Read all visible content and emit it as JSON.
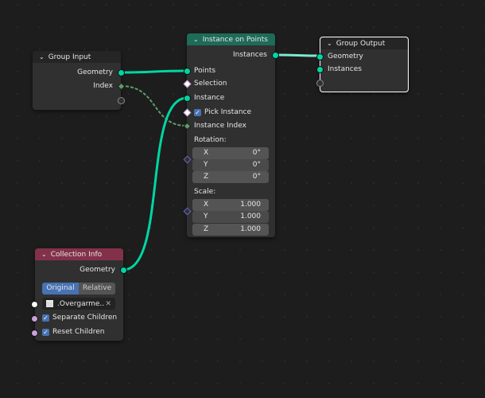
{
  "group_input": {
    "title": "Group Input",
    "outputs": [
      "Geometry",
      "Index"
    ]
  },
  "instance_on_points": {
    "title": "Instance on Points",
    "output": "Instances",
    "inputs": {
      "points": "Points",
      "selection": "Selection",
      "instance": "Instance",
      "pick_instance": "Pick Instance",
      "instance_index": "Instance Index"
    },
    "pick_instance_checked": true,
    "rotation": {
      "label": "Rotation:",
      "x": "0°",
      "y": "0°",
      "z": "0°"
    },
    "scale": {
      "label": "Scale:",
      "x": "1.000",
      "y": "1.000",
      "z": "1.000"
    },
    "axes": [
      "X",
      "Y",
      "Z"
    ]
  },
  "group_output": {
    "title": "Group Output",
    "inputs": [
      "Geometry",
      "Instances"
    ]
  },
  "collection_info": {
    "title": "Collection Info",
    "output": "Geometry",
    "modes": [
      "Original",
      "Relative"
    ],
    "active_mode": "Original",
    "collection": ".Overgarme...",
    "separate_children": "Separate Children",
    "reset_children": "Reset Children",
    "separate_checked": true,
    "reset_checked": true
  },
  "colors": {
    "geometry_socket": "#00d6a3",
    "header_geometry": "#1e6b58",
    "header_input": "#83314a",
    "accent": "#4772b3"
  }
}
